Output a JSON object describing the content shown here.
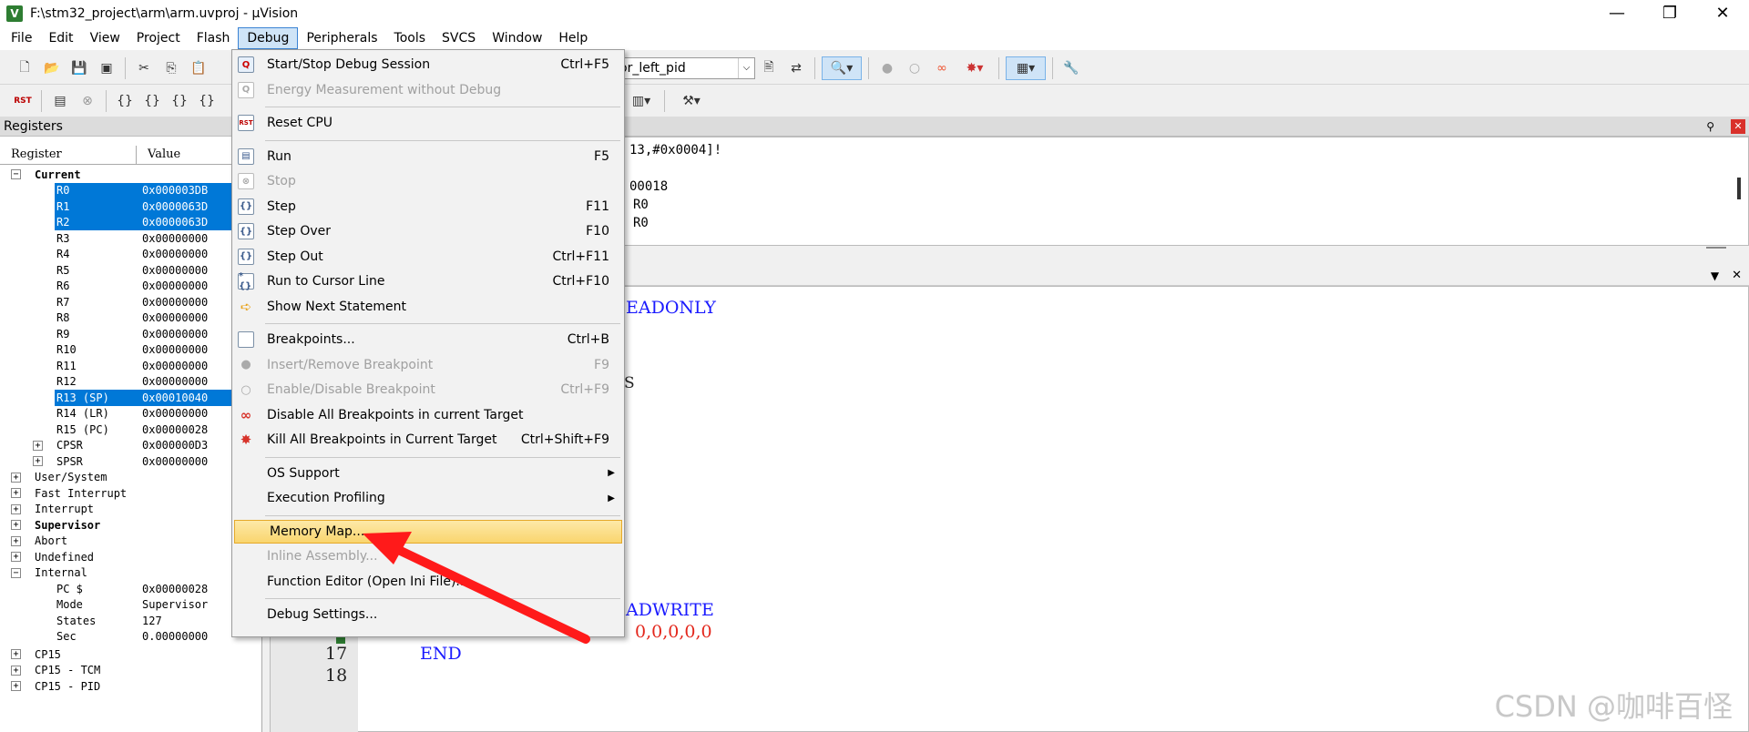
{
  "window": {
    "title": "F:\\stm32_project\\arm\\arm.uvproj - µVision",
    "app_icon": "V",
    "minimize": "—",
    "restore": "❐",
    "close": "✕"
  },
  "menubar": [
    "File",
    "Edit",
    "View",
    "Project",
    "Flash",
    "Debug",
    "Peripherals",
    "Tools",
    "SVCS",
    "Window",
    "Help"
  ],
  "toolbar": {
    "target_combo": "otor_left_pid",
    "rst_label": "RST"
  },
  "registers_panel": {
    "title": "Registers",
    "col_register": "Register",
    "col_value": "Value",
    "pin": "⚲",
    "close": "✕",
    "rows": [
      {
        "exp": "−",
        "name": "Current",
        "value": "",
        "bold": true
      },
      {
        "name": "R0",
        "value": "0x000003DB",
        "sel": true
      },
      {
        "name": "R1",
        "value": "0x0000063D",
        "sel": true
      },
      {
        "name": "R2",
        "value": "0x0000063D",
        "sel": true
      },
      {
        "name": "R3",
        "value": "0x00000000"
      },
      {
        "name": "R4",
        "value": "0x00000000"
      },
      {
        "name": "R5",
        "value": "0x00000000"
      },
      {
        "name": "R6",
        "value": "0x00000000"
      },
      {
        "name": "R7",
        "value": "0x00000000"
      },
      {
        "name": "R8",
        "value": "0x00000000"
      },
      {
        "name": "R9",
        "value": "0x00000000"
      },
      {
        "name": "R10",
        "value": "0x00000000"
      },
      {
        "name": "R11",
        "value": "0x00000000"
      },
      {
        "name": "R12",
        "value": "0x00000000"
      },
      {
        "name": "R13 (SP)",
        "value": "0x00010040",
        "sel": true
      },
      {
        "name": "R14 (LR)",
        "value": "0x00000000"
      },
      {
        "name": "R15 (PC)",
        "value": "0x00000028"
      },
      {
        "exp": "+",
        "name": "CPSR",
        "value": "0x000000D3"
      },
      {
        "exp": "+",
        "name": "SPSR",
        "value": "0x00000000"
      },
      {
        "exp": "+",
        "name": "User/System",
        "value": ""
      },
      {
        "exp": "+",
        "name": "Fast Interrupt",
        "value": ""
      },
      {
        "exp": "+",
        "name": "Interrupt",
        "value": ""
      },
      {
        "exp": "+",
        "name": "Supervisor",
        "value": "",
        "bold": true
      },
      {
        "exp": "+",
        "name": "Abort",
        "value": ""
      },
      {
        "exp": "+",
        "name": "Undefined",
        "value": ""
      },
      {
        "exp": "−",
        "name": "Internal",
        "value": ""
      },
      {
        "name": "PC  $",
        "value": "0x00000028"
      },
      {
        "name": "Mode",
        "value": "Supervisor"
      },
      {
        "name": "States",
        "value": "127"
      },
      {
        "name": "Sec",
        "value": "0.00000000"
      },
      {
        "exp": "+",
        "name": "CP15",
        "value": ""
      },
      {
        "exp": "+",
        "name": "CP15 - TCM",
        "value": ""
      },
      {
        "exp": "+",
        "name": "CP15 - PID",
        "value": ""
      }
    ]
  },
  "disassembly": {
    "lines": [
      "13,#0x0004]!",
      "",
      "00018",
      "R0",
      "R0"
    ]
  },
  "editor": {
    "tab_chevron": "▼",
    "tab_close": "✕",
    "visible_fragments": [
      {
        "text": "EADONLY",
        "color": "blue"
      },
      {
        "text": "S",
        "color": "black"
      },
      {
        "text": "ADWRITE",
        "color": "blue"
      },
      {
        "text": "0,0,0,0,0",
        "color": "red"
      }
    ],
    "lines": [
      {
        "no": "17",
        "code": "END"
      },
      {
        "no": "18",
        "code": ""
      }
    ]
  },
  "debug_menu": {
    "items": [
      {
        "icon": "start-stop-debug-icon",
        "glyph": "Q",
        "label": "Start/Stop Debug Session",
        "shortcut": "Ctrl+F5",
        "disabled": false
      },
      {
        "icon": "energy-measurement-icon",
        "glyph": "Q",
        "label": "Energy Measurement without Debug",
        "shortcut": "",
        "disabled": true
      },
      {
        "sep": true
      },
      {
        "icon": "reset-cpu-icon",
        "glyph": "RST",
        "label": "Reset CPU",
        "shortcut": "",
        "disabled": false
      },
      {
        "sep": true
      },
      {
        "icon": "run-icon",
        "glyph": "▤",
        "label": "Run",
        "shortcut": "F5",
        "disabled": false
      },
      {
        "icon": "stop-icon",
        "glyph": "⊗",
        "label": "Stop",
        "shortcut": "",
        "disabled": true
      },
      {
        "icon": "step-icon",
        "glyph": "{}",
        "label": "Step",
        "shortcut": "F11",
        "disabled": false
      },
      {
        "icon": "step-over-icon",
        "glyph": "{}",
        "label": "Step Over",
        "shortcut": "F10",
        "disabled": false
      },
      {
        "icon": "step-out-icon",
        "glyph": "{}",
        "label": "Step Out",
        "shortcut": "Ctrl+F11",
        "disabled": false
      },
      {
        "icon": "run-to-cursor-icon",
        "glyph": "*{}",
        "label": "Run to Cursor Line",
        "shortcut": "Ctrl+F10",
        "disabled": false
      },
      {
        "icon": "show-next-statement-icon",
        "glyph": "➪",
        "label": "Show Next Statement",
        "shortcut": "",
        "disabled": false
      },
      {
        "sep": true
      },
      {
        "icon": "breakpoints-icon",
        "glyph": "",
        "label": "Breakpoints...",
        "shortcut": "Ctrl+B",
        "disabled": false
      },
      {
        "icon": "insert-breakpoint-icon",
        "glyph": "●",
        "label": "Insert/Remove Breakpoint",
        "shortcut": "F9",
        "disabled": true
      },
      {
        "icon": "enable-breakpoint-icon",
        "glyph": "○",
        "label": "Enable/Disable Breakpoint",
        "shortcut": "Ctrl+F9",
        "disabled": true
      },
      {
        "icon": "disable-all-breakpoints-icon",
        "glyph": "∞",
        "label": "Disable All Breakpoints in current Target",
        "shortcut": "",
        "disabled": false
      },
      {
        "icon": "kill-all-breakpoints-icon",
        "glyph": "✸",
        "label": "Kill All Breakpoints in Current Target",
        "shortcut": "Ctrl+Shift+F9",
        "disabled": false
      },
      {
        "sep": true
      },
      {
        "icon": "",
        "glyph": "",
        "label": "OS Support",
        "shortcut": "",
        "disabled": false,
        "submenu": true
      },
      {
        "icon": "",
        "glyph": "",
        "label": "Execution Profiling",
        "shortcut": "",
        "disabled": false,
        "submenu": true
      },
      {
        "sep": true
      },
      {
        "icon": "",
        "glyph": "",
        "label": "Memory Map...",
        "shortcut": "",
        "disabled": false,
        "highlight": true
      },
      {
        "icon": "",
        "glyph": "",
        "label": "Inline Assembly...",
        "shortcut": "",
        "disabled": true
      },
      {
        "icon": "",
        "glyph": "",
        "label": "Function Editor (Open Ini File)...",
        "shortcut": "",
        "disabled": false
      },
      {
        "sep": true
      },
      {
        "icon": "",
        "glyph": "",
        "label": "Debug Settings...",
        "shortcut": "",
        "disabled": false
      }
    ]
  },
  "colors": {
    "selection": "#0078d7",
    "menu_highlight": "#f9d56e",
    "annotation_arrow": "#ff1a1a",
    "code_keyword": "#1a1aff",
    "code_number": "#e3261b"
  },
  "watermark": "CSDN @咖啡百怪"
}
